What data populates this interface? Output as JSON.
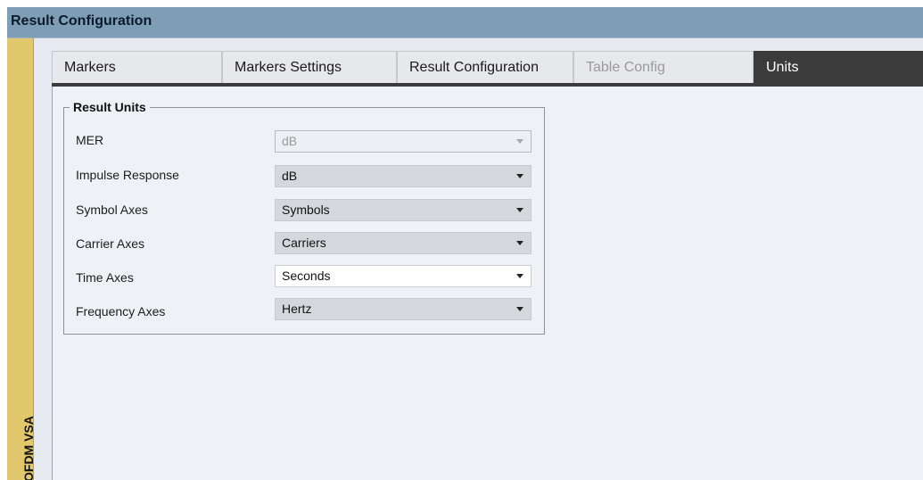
{
  "window": {
    "title": "Result Configuration"
  },
  "sidebar": {
    "label": "OFDM VSA"
  },
  "tabs": [
    {
      "label": "Markers",
      "state": "normal"
    },
    {
      "label": "Markers Settings",
      "state": "normal"
    },
    {
      "label": "Result Configuration",
      "state": "normal"
    },
    {
      "label": "Table Config",
      "state": "disabled"
    },
    {
      "label": "Units",
      "state": "active"
    }
  ],
  "result_units": {
    "legend": "Result Units",
    "rows": [
      {
        "label": "MER",
        "value": "dB",
        "enabled": false
      },
      {
        "label": "Impulse Response",
        "value": "dB",
        "enabled": true
      },
      {
        "label": "Symbol Axes",
        "value": "Symbols",
        "enabled": true
      },
      {
        "label": "Carrier Axes",
        "value": "Carriers",
        "enabled": true
      },
      {
        "label": "Time Axes",
        "value": "Seconds",
        "enabled": true,
        "focused": true
      },
      {
        "label": "Frequency Axes",
        "value": "Hertz",
        "enabled": true
      }
    ]
  }
}
